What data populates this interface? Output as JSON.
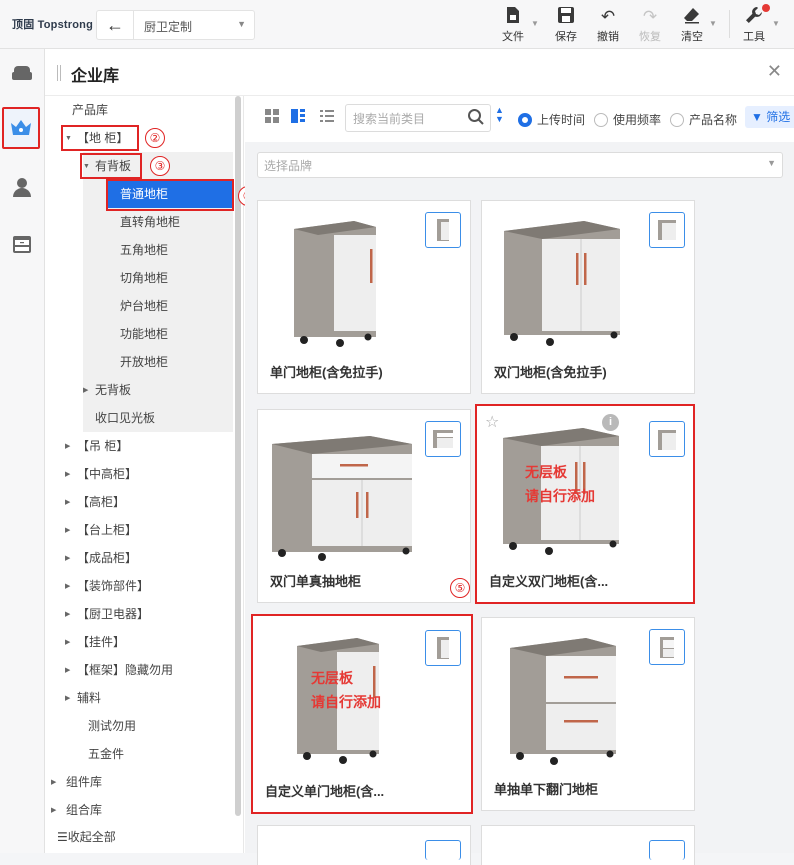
{
  "app": {
    "logo": "顶固 Topstrong",
    "mode": "厨卫定制"
  },
  "toolbar": {
    "file": "文件",
    "save": "保存",
    "undo": "撤销",
    "redo": "恢复",
    "clear": "清空",
    "tools": "工具"
  },
  "panel": {
    "title": "企业库",
    "collapse_all": "收起全部"
  },
  "tree": {
    "root": "产品库",
    "level1_open": "【地 柜】",
    "level2_open": "有背板",
    "leaves": [
      "普通地柜",
      "直转角地柜",
      "五角地柜",
      "切角地柜",
      "炉台地柜",
      "功能地柜",
      "开放地柜"
    ],
    "level2_other": [
      "无背板",
      "收口见光板"
    ],
    "level1_other": [
      "【吊 柜】",
      "【中高柜】",
      "【高柜】",
      "【台上柜】",
      "【成品柜】",
      "【装饰部件】",
      "【厨卫电器】",
      "【挂件】",
      "【框架】隐藏勿用",
      "辅料"
    ],
    "plain": [
      "测试勿用",
      "五金件"
    ],
    "top_other": [
      "组件库",
      "组合库"
    ],
    "selected": "普通地柜"
  },
  "annotations": [
    "①",
    "②",
    "③",
    "④",
    "⑤"
  ],
  "content": {
    "search_placeholder": "搜索当前类目",
    "sort_options": [
      "上传时间",
      "使用频率",
      "产品名称"
    ],
    "sort_selected": "上传时间",
    "filter_label": "筛选",
    "brand_placeholder": "选择品牌",
    "overlay_text": [
      "无层板",
      "请自行添加"
    ],
    "products": [
      {
        "name": "单门地柜(含免拉手)"
      },
      {
        "name": "双门地柜(含免拉手)"
      },
      {
        "name": "双门单真抽地柜"
      },
      {
        "name": "自定义双门地柜(含..."
      },
      {
        "name": "自定义单门地柜(含..."
      },
      {
        "name": "单抽单下翻门地柜"
      }
    ]
  },
  "colors": {
    "accent": "#1f6fe5",
    "highlight": "#e02424",
    "cabinet_body": "#a29d97",
    "door": "#f0f0f0",
    "handle": "#c0664a"
  }
}
